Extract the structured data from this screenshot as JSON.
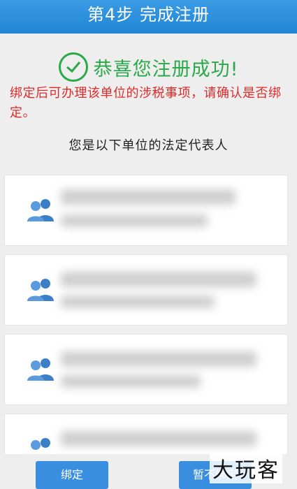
{
  "header": {
    "title": "第4步 完成注册"
  },
  "success": {
    "message": "恭喜您注册成功!"
  },
  "warning": {
    "text": "绑定后可办理该单位的涉税事项，请确认是否绑定。"
  },
  "subtitle": "您是以下单位的法定代表人",
  "cards": [
    {
      "company_name": "",
      "detail": ""
    },
    {
      "company_name": "",
      "detail": ""
    },
    {
      "company_name": "",
      "detail": ""
    },
    {
      "company_name": "",
      "detail": ""
    }
  ],
  "buttons": {
    "bind_label": "绑定",
    "later_label": "暂不绑定"
  },
  "watermark": "大玩客",
  "colors": {
    "header_blue": "#2286d6",
    "success_green": "#2aa84a",
    "warning_red": "#e02a2a",
    "button_blue": "#3a8ee0"
  },
  "icons": {
    "success": "check-circle-icon",
    "company": "users-icon"
  }
}
